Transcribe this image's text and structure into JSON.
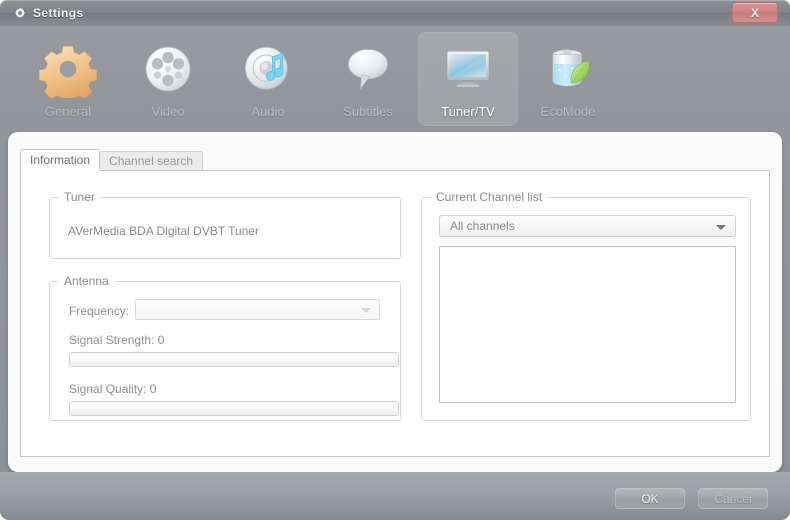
{
  "window": {
    "title": "Settings",
    "title_icon": "gear-icon",
    "close_label": "X"
  },
  "toolbar": {
    "items": [
      {
        "label": "General",
        "icon": "gear-icon",
        "selected": false
      },
      {
        "label": "Video",
        "icon": "film-reel-icon",
        "selected": false
      },
      {
        "label": "Audio",
        "icon": "speaker-note-icon",
        "selected": false
      },
      {
        "label": "Subtitles",
        "icon": "speech-bubble-icon",
        "selected": false
      },
      {
        "label": "Tuner/TV",
        "icon": "tv-monitor-icon",
        "selected": true
      },
      {
        "label": "EcoMode",
        "icon": "battery-leaf-icon",
        "selected": false
      }
    ]
  },
  "tabs": [
    {
      "label": "Information",
      "active": true
    },
    {
      "label": "Channel search",
      "active": false
    }
  ],
  "information_tab": {
    "tuner_group": {
      "title": "Tuner",
      "device_name": "AVerMedia BDA Digital DVBT Tuner"
    },
    "antenna_group": {
      "title": "Antenna",
      "frequency_label": "Frequency:",
      "frequency_value": "",
      "frequency_placeholder": "",
      "signal_strength_label": "Signal Strength: 0",
      "signal_strength_value": 0,
      "signal_quality_label": "Signal Quality: 0",
      "signal_quality_value": 0
    },
    "channel_list_group": {
      "title": "Current Channel list",
      "filter_selected": "All channels",
      "channels": []
    }
  },
  "footer": {
    "ok_label": "OK",
    "cancel_label": "Cancel"
  },
  "colors": {
    "window_chrome": "#93969a",
    "titlebar": "#7f8286",
    "close_button": "#cf8383",
    "panel_bg": "#fafafa",
    "tab_active_bg": "#ffffff",
    "text_muted": "#8a8a8a",
    "selected_label": "#ffffff"
  }
}
